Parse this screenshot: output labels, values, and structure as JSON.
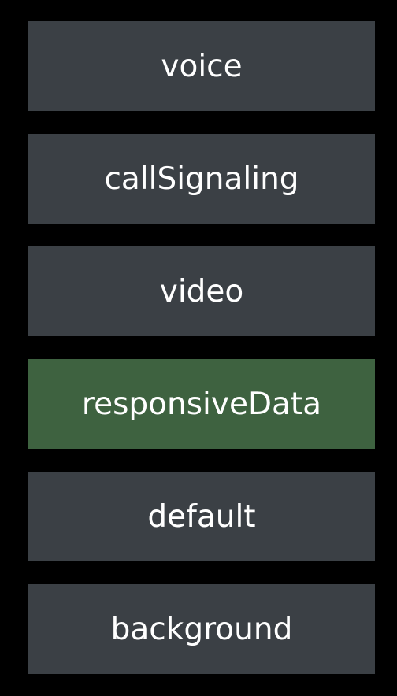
{
  "colors": {
    "background": "#000000",
    "row": "#3b4045",
    "selected_row": "#3e6240",
    "text": "#ffffff"
  },
  "service_types": {
    "items": [
      {
        "label": "voice",
        "selected": false
      },
      {
        "label": "callSignaling",
        "selected": false
      },
      {
        "label": "video",
        "selected": false
      },
      {
        "label": "responsiveData",
        "selected": true
      },
      {
        "label": "default",
        "selected": false
      },
      {
        "label": "background",
        "selected": false
      }
    ]
  }
}
